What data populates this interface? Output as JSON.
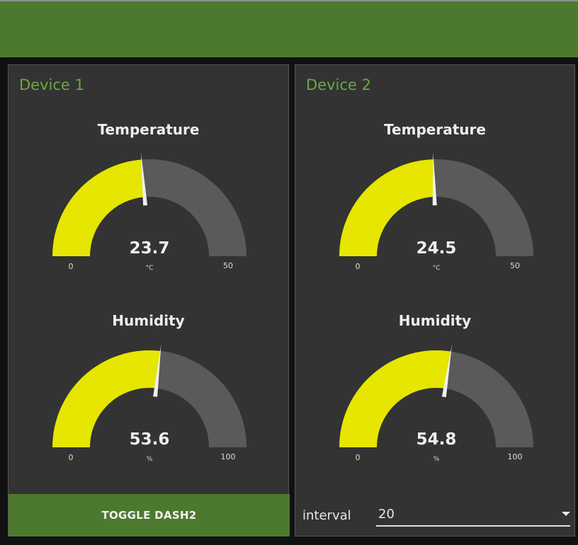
{
  "colors": {
    "header": "#4b7a2f",
    "panel": "#333333",
    "title": "#6aa841",
    "gauge_fill": "#e6e600",
    "gauge_track": "#5a5a5a",
    "needle": "#f0f0f0"
  },
  "devices": [
    {
      "title": "Device 1",
      "gauges": [
        {
          "title": "Temperature",
          "value": "23.7",
          "unit": "°C",
          "min": "0",
          "max": "50"
        },
        {
          "title": "Humidity",
          "value": "53.6",
          "unit": "%",
          "min": "0",
          "max": "100"
        }
      ],
      "footer": {
        "button_label": "TOGGLE DASH2"
      }
    },
    {
      "title": "Device 2",
      "gauges": [
        {
          "title": "Temperature",
          "value": "24.5",
          "unit": "°C",
          "min": "0",
          "max": "50"
        },
        {
          "title": "Humidity",
          "value": "54.8",
          "unit": "%",
          "min": "0",
          "max": "100"
        }
      ],
      "footer": {
        "interval_label": "interval",
        "interval_value": "20"
      }
    }
  ]
}
